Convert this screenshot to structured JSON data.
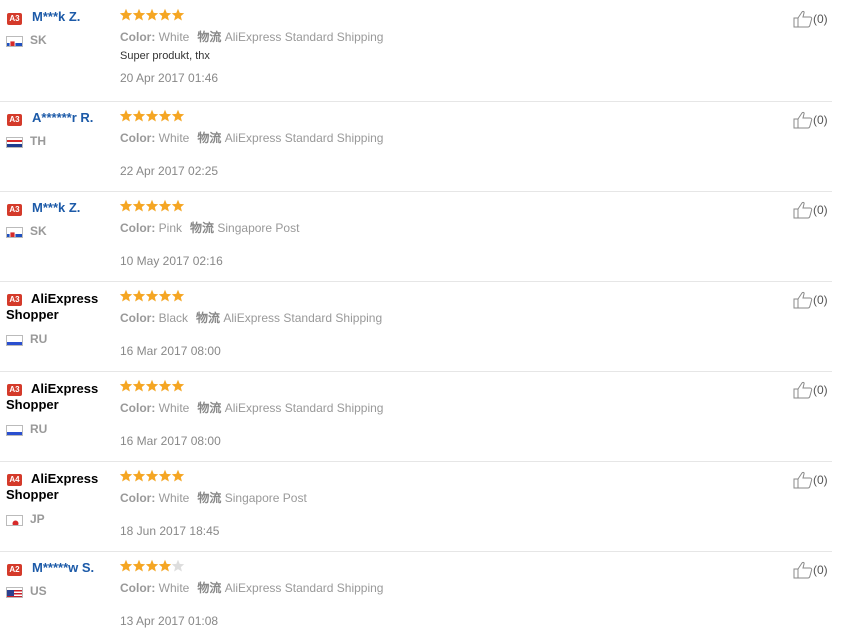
{
  "color_label": "Color:",
  "logistics_label": "物流",
  "reviews": [
    {
      "level": "A3",
      "name": "M***k Z.",
      "country": "SK",
      "rating": 5,
      "color": "White",
      "shipping": "AliExpress Standard Shipping",
      "comment": "Super produkt, thx",
      "date": "20 Apr 2017 01:46",
      "useful": "(0)",
      "flag": "sk"
    },
    {
      "level": "A3",
      "name": "A******r R.",
      "country": "TH",
      "rating": 5,
      "color": "White",
      "shipping": "AliExpress Standard Shipping",
      "comment": "",
      "date": "22 Apr 2017 02:25",
      "useful": "(0)",
      "flag": "th"
    },
    {
      "level": "A3",
      "name": "M***k Z.",
      "country": "SK",
      "rating": 5,
      "color": "Pink",
      "shipping": "Singapore Post",
      "comment": "",
      "date": "10 May 2017 02:16",
      "useful": "(0)",
      "flag": "sk"
    },
    {
      "level": "A3",
      "name": "AliExpress Shopper",
      "country": "RU",
      "rating": 5,
      "color": "Black",
      "shipping": "AliExpress Standard Shipping",
      "comment": "",
      "date": "16 Mar 2017 08:00",
      "useful": "(0)",
      "flag": "ru"
    },
    {
      "level": "A3",
      "name": "AliExpress Shopper",
      "country": "RU",
      "rating": 5,
      "color": "White",
      "shipping": "AliExpress Standard Shipping",
      "comment": "",
      "date": "16 Mar 2017 08:00",
      "useful": "(0)",
      "flag": "ru"
    },
    {
      "level": "A4",
      "name": "AliExpress Shopper",
      "country": "JP",
      "rating": 5,
      "color": "White",
      "shipping": "Singapore Post",
      "comment": "",
      "date": "18 Jun 2017 18:45",
      "useful": "(0)",
      "flag": "jp"
    },
    {
      "level": "A2",
      "name": "M*****w S.",
      "country": "US",
      "rating": 4,
      "color": "White",
      "shipping": "AliExpress Standard Shipping",
      "comment": "",
      "date": "13 Apr 2017 01:08",
      "useful": "(0)",
      "flag": "us"
    }
  ],
  "colors": {
    "badge": "#d43a2a",
    "name_link": "#1c5aa8",
    "star_on": "#f5a623",
    "star_off": "#dddddd"
  }
}
